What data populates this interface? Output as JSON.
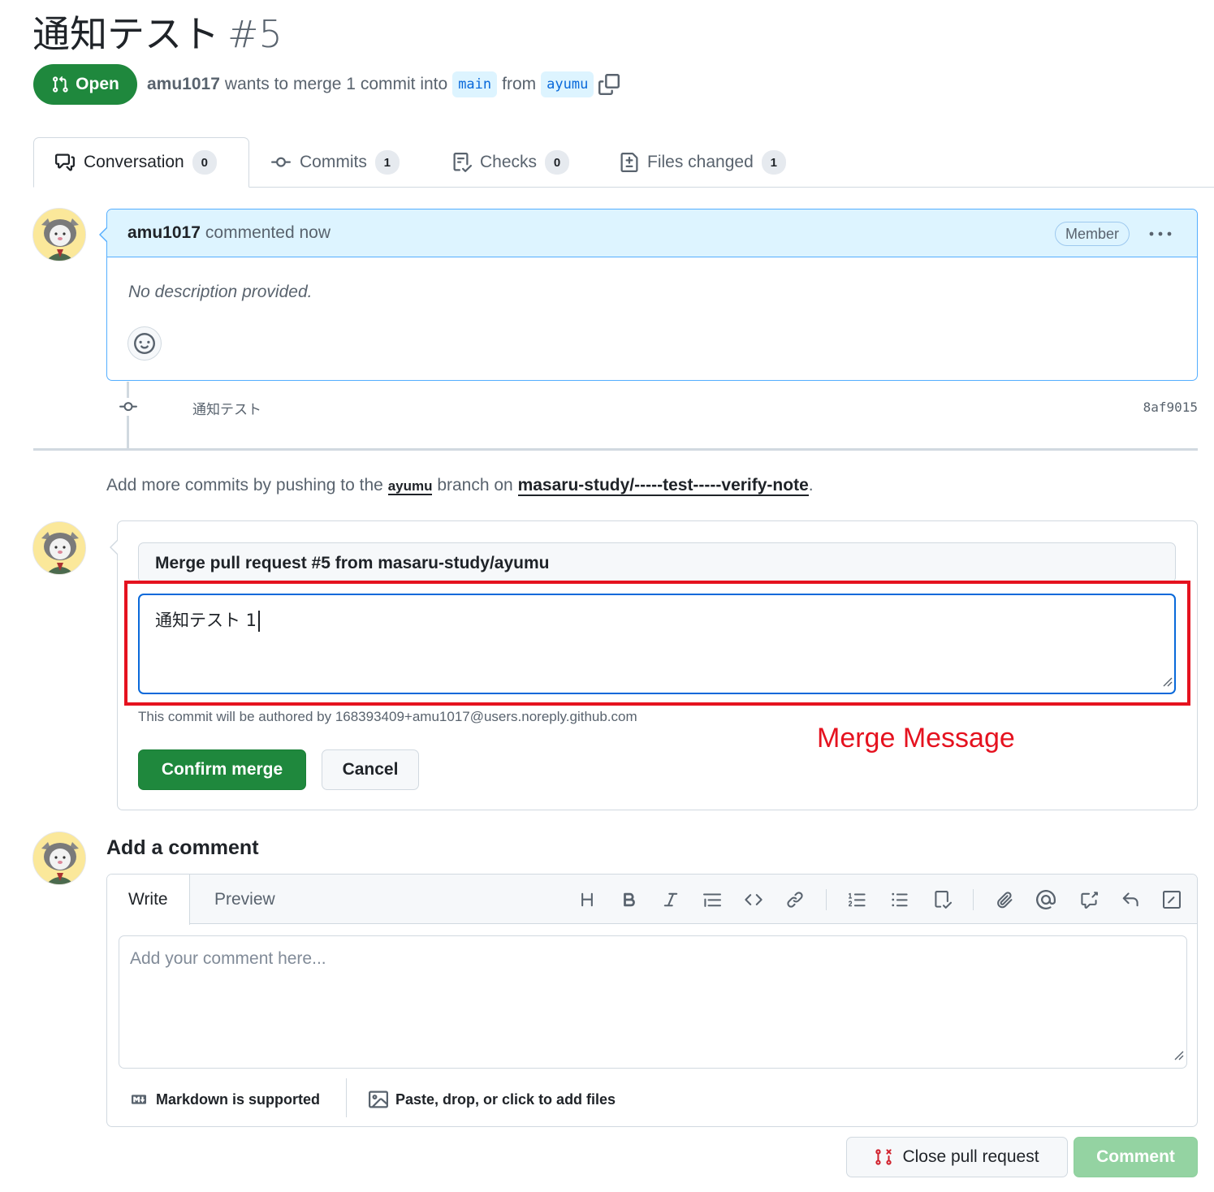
{
  "pr": {
    "title": "通知テスト",
    "number": "#5",
    "state": "Open",
    "author": "amu1017",
    "merge_text": "wants to merge 1 commit into",
    "base_branch": "main",
    "from_text": "from",
    "head_branch": "ayumu"
  },
  "tabs": [
    {
      "label": "Conversation",
      "count": "0",
      "icon": "comment-discussion-icon"
    },
    {
      "label": "Commits",
      "count": "1",
      "icon": "git-commit-icon"
    },
    {
      "label": "Checks",
      "count": "0",
      "icon": "checklist-icon"
    },
    {
      "label": "Files changed",
      "count": "1",
      "icon": "file-diff-icon"
    }
  ],
  "comment": {
    "author": "amu1017",
    "time": "commented now",
    "role": "Member",
    "body": "No description provided."
  },
  "commit": {
    "message": "通知テスト",
    "sha": "8af9015"
  },
  "hint": {
    "prefix": "Add more commits by pushing to the",
    "branch": "ayumu",
    "middle": "branch on",
    "repo": "masaru-study/-----test-----verify-note",
    "suffix": "."
  },
  "merge": {
    "title_value": "Merge pull request #5 from masaru-study/ayumu",
    "message_value": "通知テスト 1",
    "author_note": "This commit will be authored by 168393409+amu1017@users.noreply.github.com",
    "confirm_label": "Confirm merge",
    "cancel_label": "Cancel",
    "annotation": "Merge Message",
    "annotation_color": "#e5121f"
  },
  "add_comment": {
    "title": "Add a comment",
    "tab_write": "Write",
    "tab_preview": "Preview",
    "placeholder": "Add your comment here...",
    "markdown_note": "Markdown is supported",
    "files_note": "Paste, drop, or click to add files",
    "toolbar": [
      "heading-icon",
      "bold-icon",
      "italic-icon",
      "quote-icon",
      "code-icon",
      "link-icon",
      "ordered-list-icon",
      "unordered-list-icon",
      "task-list-icon",
      "attach-icon",
      "mention-icon",
      "cross-reference-icon",
      "reply-icon",
      "slash-command-icon"
    ]
  },
  "actions": {
    "close_label": "Close pull request",
    "comment_label": "Comment"
  },
  "colors": {
    "open_green": "#1f883d",
    "accent_blue": "#0969da",
    "comment_header_bg": "#ddf4ff",
    "disabled_green": "#94d3a2"
  }
}
